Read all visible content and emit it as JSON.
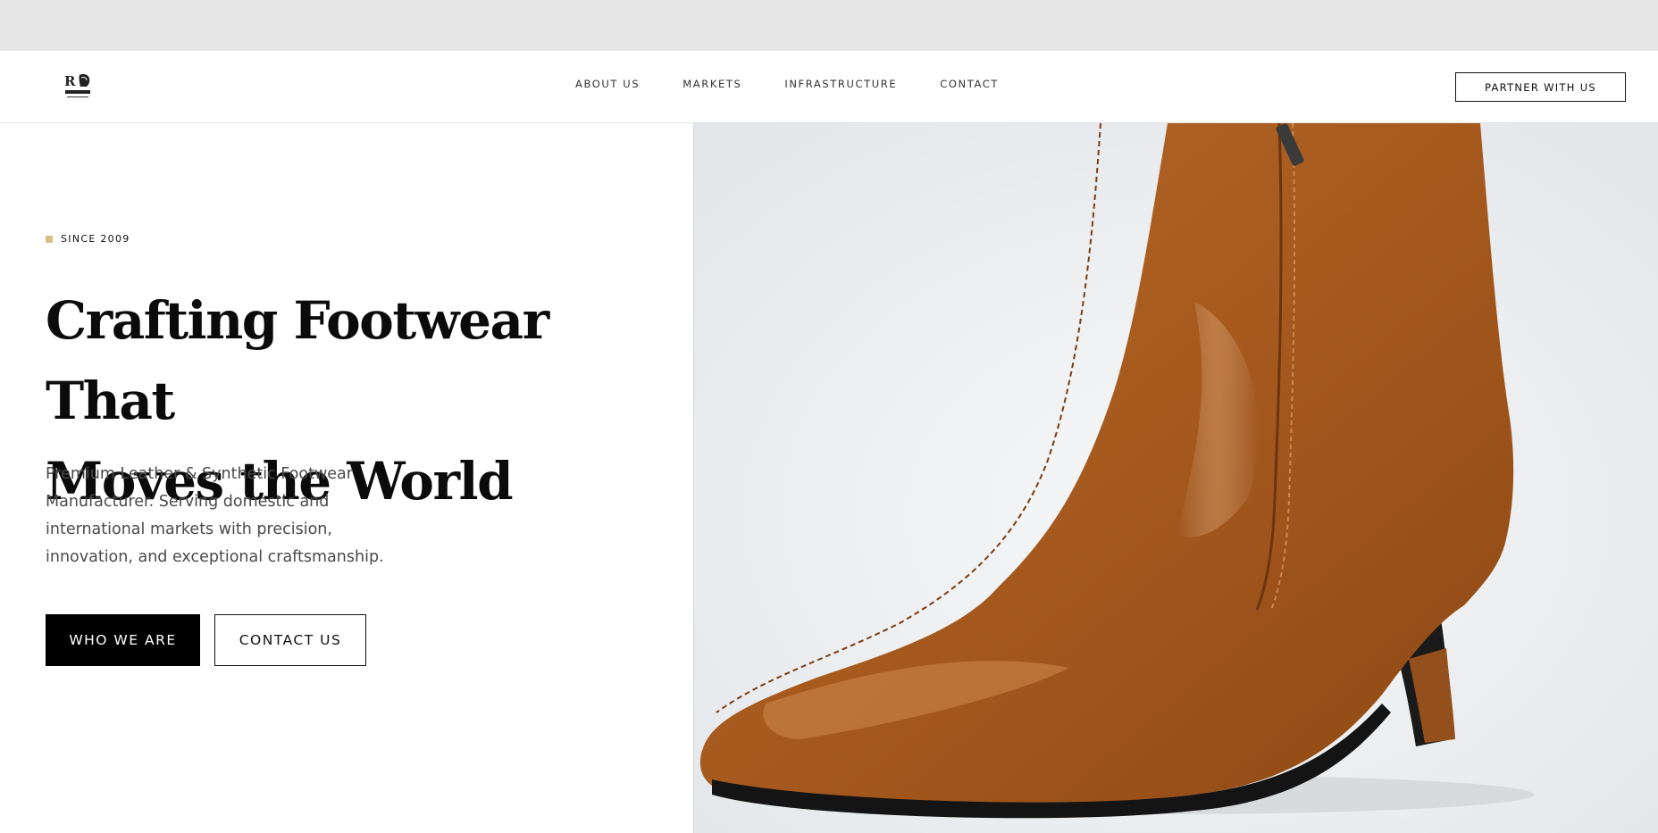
{
  "brand": {
    "logo_icon": "boot-logo-icon"
  },
  "nav": {
    "links": [
      {
        "label": "ABOUT US"
      },
      {
        "label": "MARKETS"
      },
      {
        "label": "INFRASTRUCTURE"
      },
      {
        "label": "CONTACT"
      }
    ],
    "cta_label": "PARTNER WITH US"
  },
  "hero": {
    "eyebrow": "SINCE 2009",
    "accent_color": "#d9bf86",
    "headline_line1": "Crafting Footwear That",
    "headline_line2": "Moves the World",
    "subtitle": "Premium Leather & Synthetic Footwear Manufacturer. Serving domestic and international markets with precision, innovation, and exceptional craftsmanship.",
    "primary_button": "WHO WE ARE",
    "secondary_button": "CONTACT US",
    "image": {
      "subject": "brown-leather-heeled-ankle-boot",
      "boot_color": "#a75a1e"
    }
  }
}
